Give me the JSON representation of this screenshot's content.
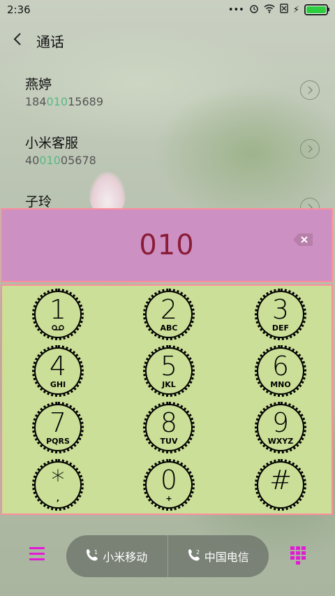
{
  "status_bar": {
    "time": "2:36",
    "icons": [
      "more-dots-icon",
      "alarm-icon",
      "wifi-icon",
      "no-sim-icon",
      "battery-icon"
    ]
  },
  "header": {
    "title": "通话"
  },
  "contacts": [
    {
      "name": "燕婷",
      "num_pre": "184",
      "num_hl": "010",
      "num_post": "15689"
    },
    {
      "name": "小米客服",
      "num_pre": "40",
      "num_hl": "010",
      "num_post": "05678"
    },
    {
      "name": "子玲",
      "num_pre": "",
      "num_hl": "",
      "num_post": ""
    }
  ],
  "dialer": {
    "input": "010"
  },
  "keys": [
    {
      "digit": "1",
      "letters": ""
    },
    {
      "digit": "2",
      "letters": "ABC"
    },
    {
      "digit": "3",
      "letters": "DEF"
    },
    {
      "digit": "4",
      "letters": "GHI"
    },
    {
      "digit": "5",
      "letters": "JKL"
    },
    {
      "digit": "6",
      "letters": "MNO"
    },
    {
      "digit": "7",
      "letters": "PQRS"
    },
    {
      "digit": "8",
      "letters": "TUV"
    },
    {
      "digit": "9",
      "letters": "WXYZ"
    },
    {
      "digit": "*",
      "letters": ","
    },
    {
      "digit": "0",
      "letters": "+"
    },
    {
      "digit": "#",
      "letters": ""
    }
  ],
  "bottom": {
    "sim1_label": "小米移动",
    "sim1_index": "1",
    "sim2_label": "中国电信",
    "sim2_index": "2"
  },
  "colors": {
    "accent": "#e21ad6",
    "display_bg": "#cc90c3",
    "keypad_bg": "#cbdf98",
    "border": "#ff8c9c",
    "highlight": "#58b883"
  }
}
